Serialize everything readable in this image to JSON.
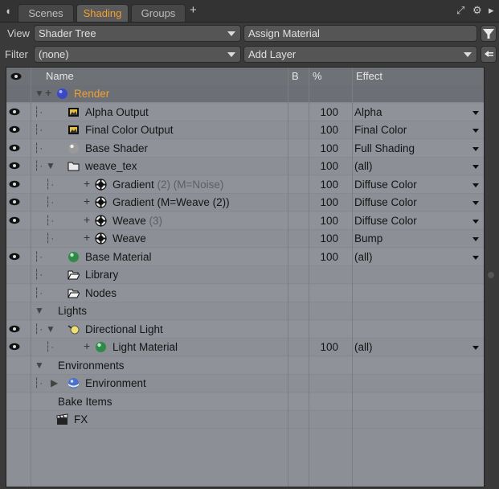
{
  "tabs": [
    {
      "label": "Scenes",
      "active": false
    },
    {
      "label": "Shading",
      "active": true
    },
    {
      "label": "Groups",
      "active": false
    }
  ],
  "toolbar": {
    "view_label": "View",
    "view_value": "Shader Tree",
    "assign_material": "Assign Material",
    "filter_label": "Filter",
    "filter_value": "(none)",
    "add_layer": "Add Layer"
  },
  "columns": {
    "name": "Name",
    "b": "B",
    "pct": "%",
    "effect": "Effect"
  },
  "rows": [
    {
      "name": "Render",
      "pct": "",
      "effect": "",
      "eye": false,
      "level": 0,
      "icon": "sphere-blue-icon",
      "selected": true
    },
    {
      "name": "Alpha Output",
      "pct": "100",
      "effect": "Alpha",
      "eye": true,
      "level": 1,
      "icon": "render-output-icon"
    },
    {
      "name": "Final Color Output",
      "pct": "100",
      "effect": "Final Color",
      "eye": true,
      "level": 1,
      "icon": "render-output-icon"
    },
    {
      "name": "Base Shader",
      "pct": "100",
      "effect": "Full Shading",
      "eye": true,
      "level": 1,
      "icon": "sphere-gray-icon"
    },
    {
      "name": "weave_tex",
      "pct": "100",
      "effect": "(all)",
      "eye": true,
      "level": 1,
      "icon": "folder-icon"
    },
    {
      "name": "Gradient",
      "suffix": "(2) (M=Noise)",
      "pct": "100",
      "effect": "Diffuse Color",
      "eye": true,
      "level": 2,
      "icon": "texture-icon"
    },
    {
      "name": "Gradient (M=Weave (2))",
      "pct": "100",
      "effect": "Diffuse Color",
      "eye": true,
      "level": 2,
      "icon": "texture-icon"
    },
    {
      "name": "Weave",
      "suffix": "(3)",
      "pct": "100",
      "effect": "Diffuse Color",
      "eye": true,
      "level": 2,
      "icon": "texture-icon"
    },
    {
      "name": "Weave",
      "pct": "100",
      "effect": "Bump",
      "eye": false,
      "level": 2,
      "icon": "texture-icon"
    },
    {
      "name": "Base Material",
      "pct": "100",
      "effect": "(all)",
      "eye": true,
      "level": 1,
      "icon": "sphere-green-icon"
    },
    {
      "name": "Library",
      "pct": "",
      "effect": "",
      "eye": false,
      "level": 1,
      "icon": "open-folder-icon"
    },
    {
      "name": "Nodes",
      "pct": "",
      "effect": "",
      "eye": false,
      "level": 1,
      "icon": "open-folder-icon"
    },
    {
      "name": "Lights",
      "pct": "",
      "effect": "",
      "eye": false,
      "level": 0,
      "icon": ""
    },
    {
      "name": "Directional Light",
      "pct": "",
      "effect": "",
      "eye": true,
      "level": 1,
      "icon": "light-icon"
    },
    {
      "name": "Light Material",
      "pct": "100",
      "effect": "(all)",
      "eye": true,
      "level": 2,
      "icon": "sphere-green-icon"
    },
    {
      "name": "Environments",
      "pct": "",
      "effect": "",
      "eye": false,
      "level": 0,
      "icon": ""
    },
    {
      "name": "Environment",
      "pct": "",
      "effect": "",
      "eye": false,
      "level": 1,
      "icon": "environment-icon"
    },
    {
      "name": "Bake Items",
      "pct": "",
      "effect": "",
      "eye": false,
      "level": 0,
      "icon": ""
    },
    {
      "name": "FX",
      "pct": "",
      "effect": "",
      "eye": false,
      "level": 0,
      "icon": "clapper-icon"
    }
  ],
  "colors": {
    "accent": "#f0a030",
    "panel": "#8c9096",
    "background": "#3a3a3a"
  }
}
